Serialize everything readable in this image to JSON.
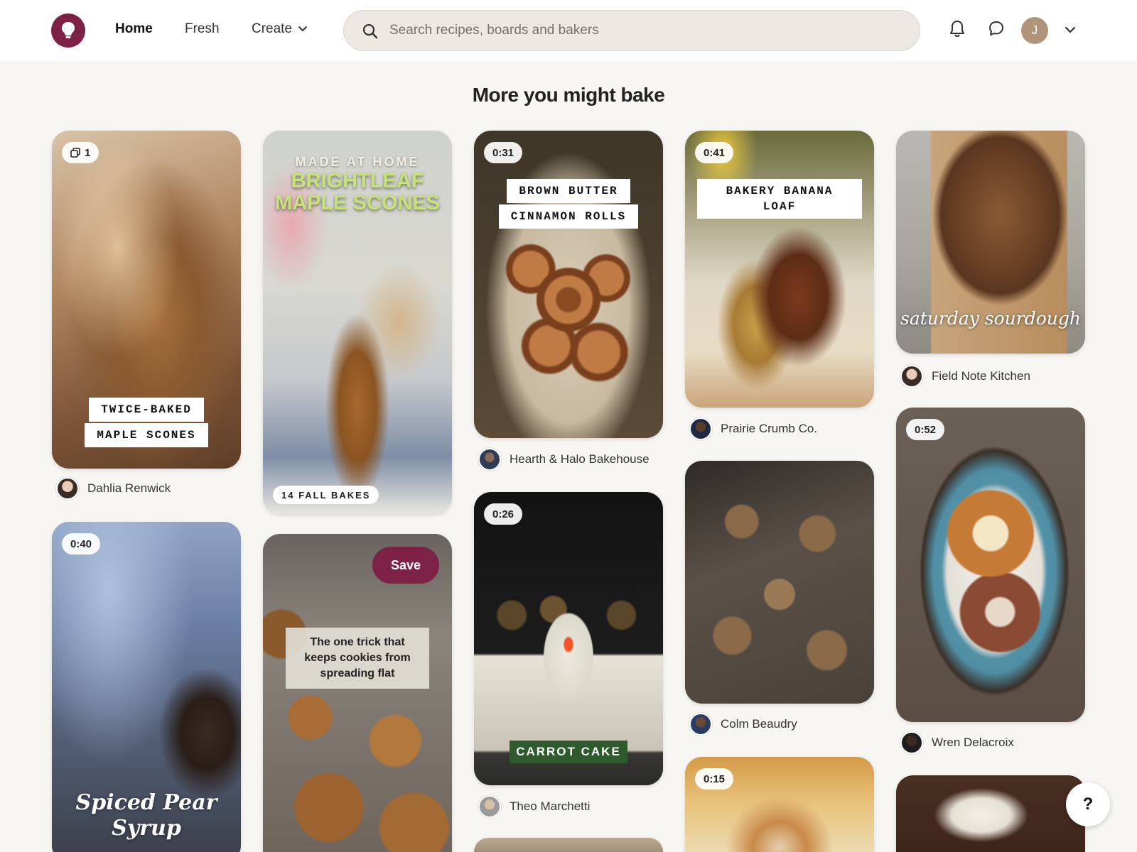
{
  "header": {
    "nav": {
      "home": "Home",
      "fresh": "Fresh",
      "create": "Create"
    },
    "search_placeholder": "Search recipes, boards and bakers",
    "avatar_initial": "J"
  },
  "section_title": "More you might bake",
  "pins": {
    "maple_scones": {
      "badge": "1",
      "line1": "TWICE-BAKED",
      "line2": "MAPLE SCONES",
      "author": "Dahlia Renwick"
    },
    "brightleaf": {
      "kicker": "MADE AT HOME",
      "title_line1": "BRIGHTLEAF",
      "title_line2": "MAPLE SCONES",
      "footer_tag": "14 FALL BAKES"
    },
    "cinnamon_rolls": {
      "duration": "0:31",
      "line1": "BROWN BUTTER",
      "line2": "CINNAMON ROLLS",
      "author": "Hearth & Halo Bakehouse"
    },
    "banana_loaf": {
      "duration": "0:41",
      "title": "BAKERY BANANA LOAF",
      "author": "Prairie Crumb Co."
    },
    "sourdough": {
      "caption": "saturday sourdough",
      "author": "Field Note Kitchen"
    },
    "pear_syrup": {
      "duration": "0:40",
      "title_line1": "Spiced Pear",
      "title_line2": "Syrup"
    },
    "cookies_tip": {
      "save_label": "Save",
      "tip": "The one trick that keeps cookies from spreading flat"
    },
    "carrot_cake": {
      "duration": "0:26",
      "label": "CARROT CAKE",
      "author": "Theo Marchetti"
    },
    "gingerbread": {
      "author": "Colm Beaudry"
    },
    "cinnamon_buns": {
      "duration": "0:52",
      "author": "Wren Delacroix"
    },
    "dessert": {
      "duration": "0:15"
    }
  },
  "help_label": "?"
}
